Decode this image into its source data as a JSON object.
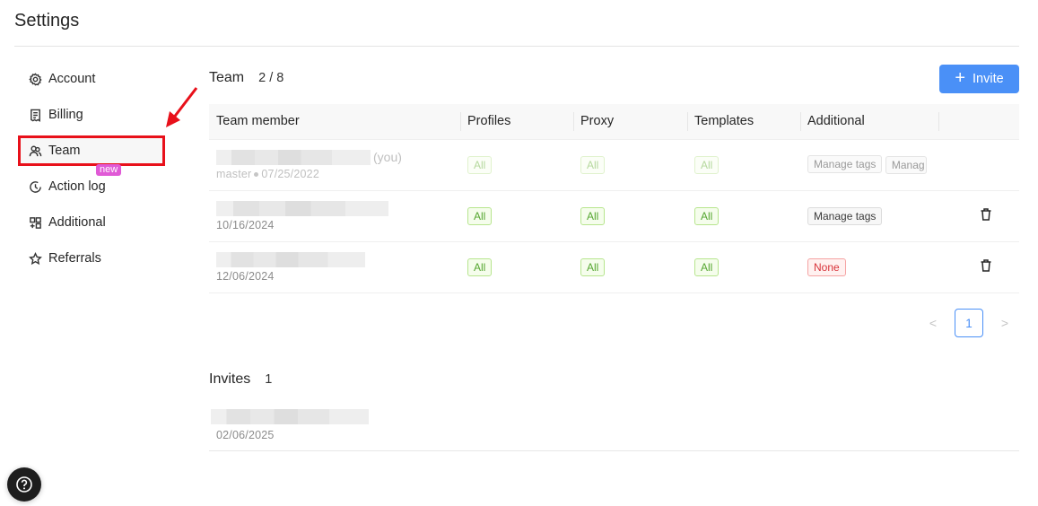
{
  "page": {
    "title": "Settings"
  },
  "sidebar": {
    "items": [
      {
        "label": "Account",
        "icon": "gear-icon"
      },
      {
        "label": "Billing",
        "icon": "receipt-icon"
      },
      {
        "label": "Team",
        "icon": "users-icon",
        "active": true
      },
      {
        "label": "Action log",
        "icon": "clock-icon",
        "badge": "new"
      },
      {
        "label": "Additional",
        "icon": "grid-plus-icon"
      },
      {
        "label": "Referrals",
        "icon": "star-icon"
      }
    ]
  },
  "team": {
    "title": "Team",
    "count": "2 / 8",
    "invite_button": {
      "label": "Invite",
      "icon": "plus-icon"
    },
    "columns": [
      "Team member",
      "Profiles",
      "Proxy",
      "Templates",
      "Additional",
      ""
    ],
    "rows": [
      {
        "name": "[redacted]",
        "you_label": "(you)",
        "role": "master",
        "date": "07/25/2022",
        "profiles": "All",
        "proxy": "All",
        "templates": "All",
        "additional": [
          "Manage tags",
          "Manag"
        ],
        "deletable": false
      },
      {
        "name": "[redacted]",
        "date": "10/16/2024",
        "profiles": "All",
        "proxy": "All",
        "templates": "All",
        "additional": [
          "Manage tags"
        ],
        "deletable": true
      },
      {
        "name": "[redacted]",
        "date": "12/06/2024",
        "profiles": "All",
        "proxy": "All",
        "templates": "All",
        "additional": [
          "None"
        ],
        "deletable": true
      }
    ],
    "pagination": {
      "current_page": "1"
    }
  },
  "invites": {
    "title": "Invites",
    "count": "1",
    "items": [
      {
        "email": "[redacted]",
        "date": "02/06/2025"
      }
    ]
  },
  "help_button": {
    "icon": "question-icon"
  },
  "colors": {
    "accent": "#4a90f7",
    "highlight_box": "#e8101a",
    "new_badge": "#e05ad6",
    "tag_green": "#55a630",
    "tag_red": "#d8333a"
  }
}
